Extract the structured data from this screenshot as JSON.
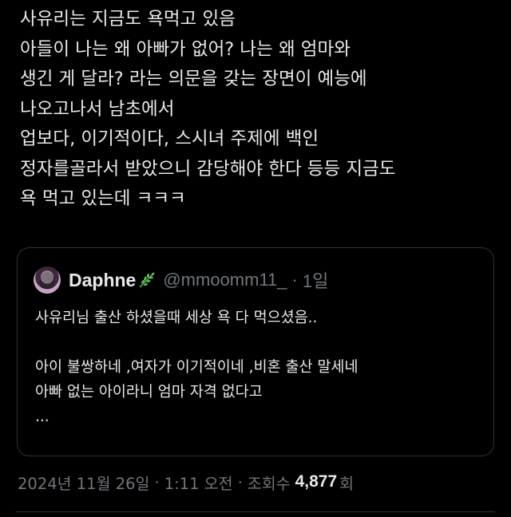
{
  "tweet": {
    "lines": [
      "사유리는 지금도 욕먹고 있음",
      "아들이 나는 왜 아빠가 없어? 나는 왜 엄마와",
      "생긴 게 달라? 라는 의문을 갖는 장면이 예능에",
      "나오고나서 남초에서",
      "업보다, 이기적이다, 스시녀 주제에 백인",
      "정자를골라서 받았으니 감당해야 한다 등등 지금도",
      "욕 먹고 있는데 ㅋㅋㅋ"
    ]
  },
  "quoted_tweet": {
    "display_name": "Daphne",
    "name_emoji_icon": "herb-leaf-icon",
    "handle": "@mmoomm11_",
    "separator": "·",
    "age": "1일",
    "lines": [
      "사유리님 출산 하셨을때 세상 욕 다 먹으셨음..",
      "",
      "아이 불쌍하네 ,여자가 이기적이네 ,비혼 출산 말세네",
      "아빠 없는 아이라니 엄마 자격 없다고",
      "..."
    ]
  },
  "meta": {
    "date": "2024년 11월 26일",
    "separator": "·",
    "time": "1:11 오전",
    "views_label": "조회수",
    "views_count": "4,877",
    "views_unit": "회"
  },
  "colors": {
    "background": "#000000",
    "text_primary": "#e7e9ea",
    "text_secondary": "#71767b",
    "border": "#2f3336",
    "leaf_green": "#5cb85c"
  }
}
